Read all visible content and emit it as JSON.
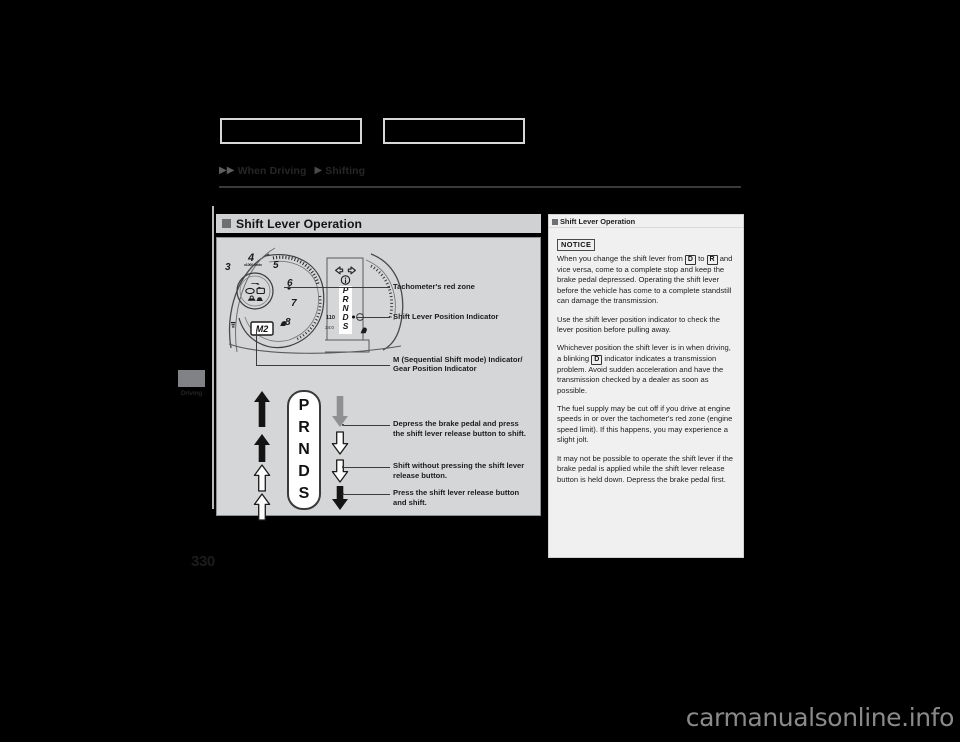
{
  "breadcrumb": {
    "arrow1": "▶▶",
    "item1": "When Driving",
    "arrow2": "▶",
    "item2": "Shifting"
  },
  "margin_tab": {
    "label": "Driving"
  },
  "page_number": "330",
  "main": {
    "header": {
      "title": "Shift Lever Operation"
    },
    "figure": {
      "tachometer_numbers": [
        "3",
        "4",
        "5",
        "6",
        "7",
        "8"
      ],
      "tachometer_unit": "x1000 r/min",
      "gear_display": "M2",
      "odometer_primary": "110",
      "odometer_secondary": "34:0",
      "gate_positions": [
        "P",
        "R",
        "N",
        "D",
        "S"
      ],
      "indicator_letters": [
        "P",
        "R",
        "N",
        "D",
        "S"
      ],
      "callouts": [
        "Tachometer's red zone",
        "Shift Lever Position Indicator"
      ],
      "callout_m_bold": "M",
      "callout_m_rest": " (Sequential Shift mode) Indicator/",
      "callout_m_line2": "Gear Position Indicator",
      "legend": [
        "Depress the brake pedal and press",
        "the shift lever release button to shift.",
        "Shift without pressing the shift lever",
        "release button.",
        "Press the shift lever release button",
        "and shift."
      ]
    }
  },
  "sidebar": {
    "header": {
      "title": "Shift Lever Operation"
    },
    "notice_badge": "NOTICE",
    "paragraphs": [
      {
        "parts": [
          {
            "t": "text",
            "v": "When you change the shift lever from "
          },
          {
            "t": "gear",
            "v": "D"
          },
          {
            "t": "text",
            "v": " to "
          },
          {
            "t": "gear",
            "v": "R"
          },
          {
            "t": "text",
            "v": " and vice versa, come to a complete stop and keep the brake pedal depressed. Operating the shift lever before the vehicle has come to a complete standstill can damage the transmission."
          }
        ]
      },
      {
        "parts": [
          {
            "t": "text",
            "v": "Use the shift lever position indicator to check the lever position before pulling away."
          }
        ]
      },
      {
        "parts": [
          {
            "t": "text",
            "v": "Whichever position the shift lever is in when driving, a blinking "
          },
          {
            "t": "gear",
            "v": "D"
          },
          {
            "t": "text",
            "v": " indicator indicates a transmission problem. Avoid sudden acceleration and have the transmission checked by a dealer as soon as possible."
          }
        ]
      },
      {
        "parts": [
          {
            "t": "text",
            "v": "The fuel supply may be cut off if you drive at engine speeds in or over the tachometer's red zone (engine speed limit). If this happens, you may experience a slight jolt."
          }
        ]
      },
      {
        "parts": [
          {
            "t": "text",
            "v": "It may not be possible to operate the shift lever if the brake pedal is applied while the shift lever release button is held down. Depress the brake pedal first."
          }
        ]
      }
    ]
  },
  "watermark": "carmanualsonline.info",
  "colors": {
    "background": "#000000",
    "panel": "#d4d6d7",
    "panel_header": "#cfd1d2",
    "sidebar": "#f0f0f0",
    "accent_gray": "#808285",
    "text": "#1d1d1d",
    "watermark": "#8a8a8a"
  }
}
